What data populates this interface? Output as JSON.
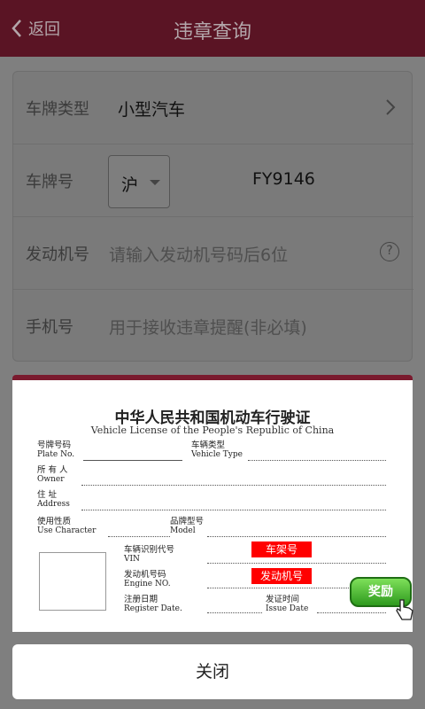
{
  "header": {
    "back_label": "返回",
    "title": "违章查询"
  },
  "form": {
    "plate_type": {
      "label": "车牌类型",
      "value": "小型汽车"
    },
    "plate_no": {
      "label": "车牌号",
      "province": "沪",
      "value": "FY9146"
    },
    "engine": {
      "label": "发动机号",
      "placeholder": "请输入发动机号码后6位"
    },
    "phone": {
      "label": "手机号",
      "placeholder": "用于接收违章提醒(非必填)"
    }
  },
  "license": {
    "title": "中华人民共和国机动车行驶证",
    "subtitle": "Vehicle License of the People's Republic of China",
    "plate_cn": "号牌号码",
    "plate_en": "Plate No.",
    "vtype_cn": "车辆类型",
    "vtype_en": "Vehicle Type",
    "owner_cn": "所 有 人",
    "owner_en": "Owner",
    "addr_cn": "住    址",
    "addr_en": "Address",
    "use_cn": "使用性质",
    "use_en": "Use Character",
    "model_cn": "品牌型号",
    "model_en": "Model",
    "vin_cn": "车辆识别代号",
    "vin_en": "VIN",
    "engine_cn": "发动机号码",
    "engine_en": "Engine NO.",
    "reg_cn": "注册日期",
    "reg_en": "Register Date.",
    "issue_cn": "发证时间",
    "issue_en": "Issue Date",
    "vin_tag": "车架号",
    "engine_tag": "发动机号",
    "reward": "奖励"
  },
  "close_label": "关闭",
  "colors": {
    "header": "#5a1424",
    "popup_border": "#7a1a2e",
    "tag": "#ff0000",
    "reward": "#3fb52a"
  }
}
